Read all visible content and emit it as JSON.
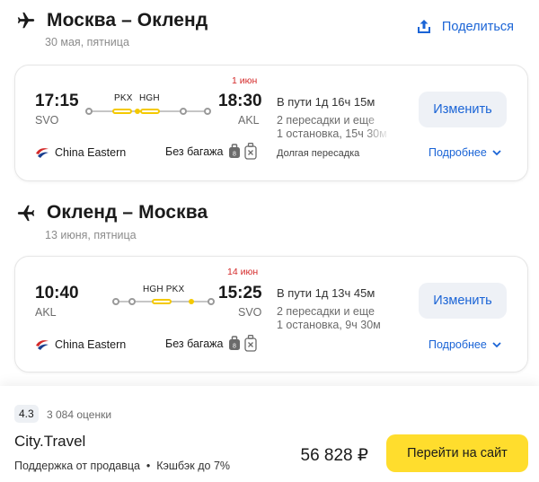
{
  "share": {
    "label": "Поделиться",
    "icon": "share-upload-icon",
    "color": "#1a64d6"
  },
  "outbound": {
    "title": "Москва – Окленд",
    "date": "30 мая, пятница",
    "departure_time": "17:15",
    "arrival_time": "18:30",
    "from_code": "SVO",
    "to_code": "AKL",
    "next_day_label": "1 июн",
    "stop_codes": [
      "PKX",
      "HGH"
    ],
    "duration": "В пути 1д 16ч 15м",
    "stops_line1": "2 пересадки и еще",
    "stops_line2": "1 остановка, 15ч 30м",
    "long_layover": "Долгая пересадка",
    "change_label": "Изменить",
    "airline": "China Eastern",
    "baggage": "Без багажа",
    "details_label": "Подробнее"
  },
  "return": {
    "title": "Окленд – Москва",
    "date": "13 июня, пятница",
    "departure_time": "10:40",
    "arrival_time": "15:25",
    "from_code": "AKL",
    "to_code": "SVO",
    "next_day_label": "14 июн",
    "stop_codes": "HGH PKX",
    "duration": "В пути 1д 13ч 45м",
    "stops_line1": "2 пересадки и еще",
    "stops_line2": "1 остановка, 9ч 30м",
    "change_label": "Изменить",
    "airline": "China Eastern",
    "baggage": "Без багажа",
    "details_label": "Подробнее"
  },
  "offer": {
    "rating": "4.3",
    "rating_count": "3 084 оценки",
    "seller": "City.Travel",
    "seller_info": "Поддержка от продавца  •  Кэшбэк до 7%",
    "price": "56 828 ₽",
    "cta_label": "Перейти на сайт",
    "cta_color": "#ffdd2d"
  }
}
